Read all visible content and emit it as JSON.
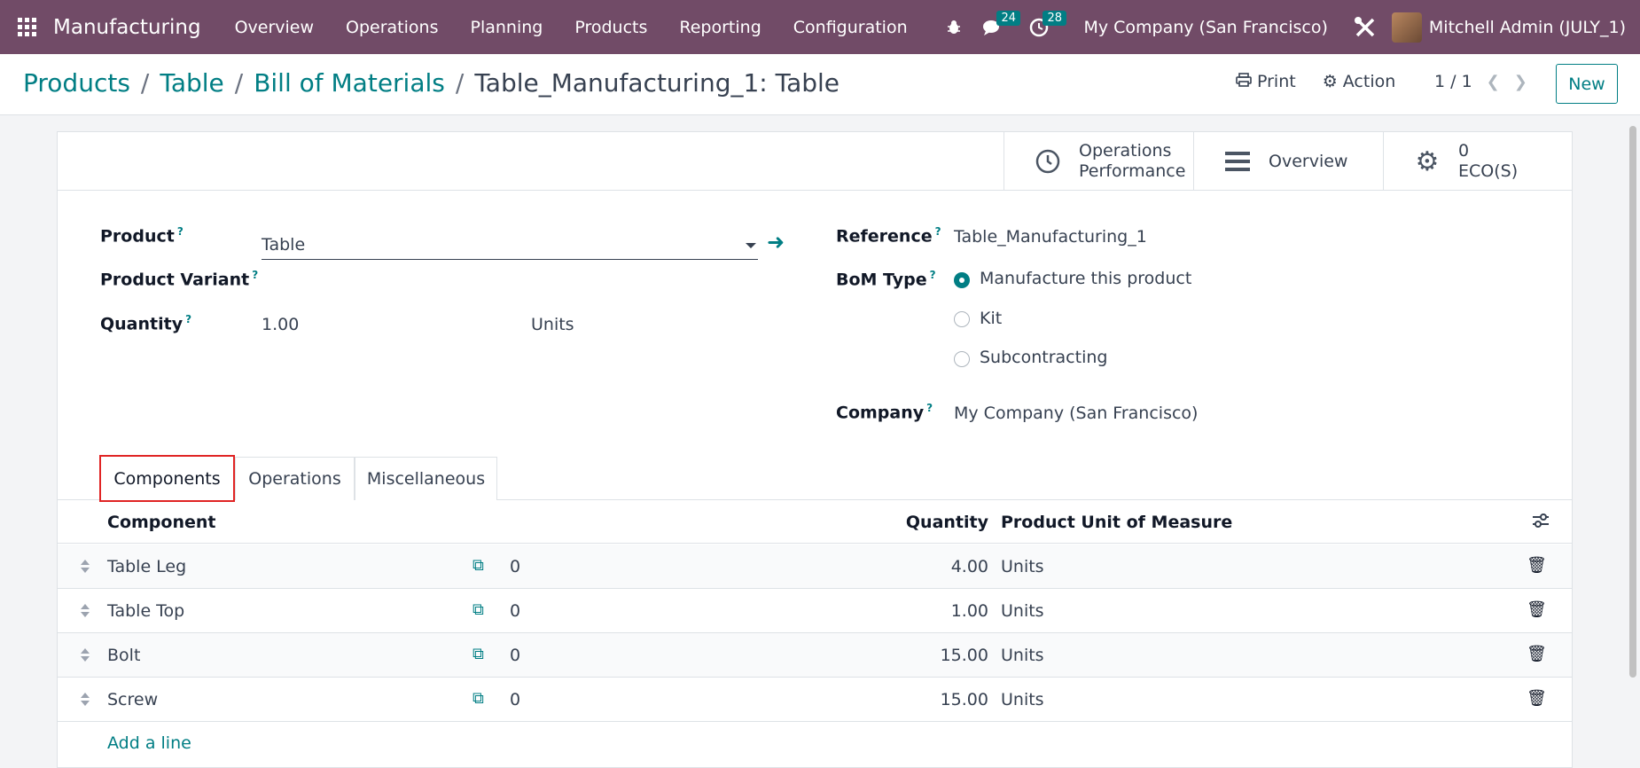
{
  "navbar": {
    "app_name": "Manufacturing",
    "menu": [
      "Overview",
      "Operations",
      "Planning",
      "Products",
      "Reporting",
      "Configuration"
    ],
    "messages_count": "24",
    "activities_count": "28",
    "company": "My Company (San Francisco)",
    "user": "Mitchell Admin (JULY_1)"
  },
  "breadcrumb": {
    "items": [
      "Products",
      "Table",
      "Bill of Materials"
    ],
    "current": "Table_Manufacturing_1: Table"
  },
  "control": {
    "print_label": "Print",
    "action_label": "Action",
    "pager": "1 / 1",
    "new_label": "New"
  },
  "smart_buttons": {
    "operations_performance": [
      "Operations",
      "Performance"
    ],
    "overview": "Overview",
    "eco_count": "0",
    "eco_label": "ECO(S)"
  },
  "form": {
    "product_label": "Product",
    "product_value": "Table",
    "variant_label": "Product Variant",
    "quantity_label": "Quantity",
    "quantity_value": "1.00",
    "quantity_uom": "Units",
    "reference_label": "Reference",
    "reference_value": "Table_Manufacturing_1",
    "bom_type_label": "BoM Type",
    "bom_types": [
      "Manufacture this product",
      "Kit",
      "Subcontracting"
    ],
    "bom_type_selected": 0,
    "company_label": "Company",
    "company_value": "My Company (San Francisco)",
    "help_mark": "?"
  },
  "tabs": [
    "Components",
    "Operations",
    "Miscellaneous"
  ],
  "table": {
    "headers": {
      "component": "Component",
      "quantity": "Quantity",
      "uom": "Product Unit of Measure"
    },
    "rows": [
      {
        "component": "Table Leg",
        "availability": "0",
        "quantity": "4.00",
        "uom": "Units"
      },
      {
        "component": "Table Top",
        "availability": "0",
        "quantity": "1.00",
        "uom": "Units"
      },
      {
        "component": "Bolt",
        "availability": "0",
        "quantity": "15.00",
        "uom": "Units"
      },
      {
        "component": "Screw",
        "availability": "0",
        "quantity": "15.00",
        "uom": "Units"
      }
    ],
    "add_line": "Add a line"
  },
  "colors": {
    "brand": "#714b67",
    "accent": "#017e84",
    "highlight": "#e02424"
  }
}
